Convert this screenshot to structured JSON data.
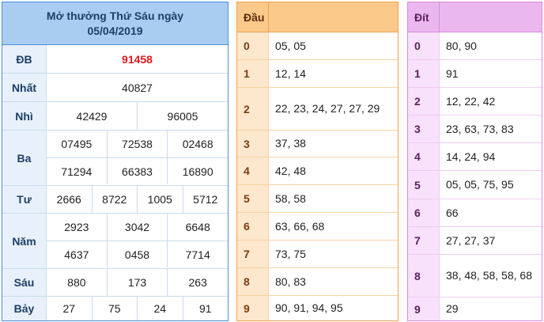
{
  "results": {
    "title_line1": "Mở thưởng Thứ Sáu ngày",
    "title_line2": "05/04/2019",
    "rows": {
      "db": {
        "label": "ĐB",
        "values": [
          "91458"
        ]
      },
      "nhat": {
        "label": "Nhất",
        "values": [
          "40827"
        ]
      },
      "nhi": {
        "label": "Nhì",
        "values": [
          "42429",
          "96005"
        ]
      },
      "ba": {
        "label": "Ba",
        "values": [
          "07495",
          "72538",
          "02468",
          "71294",
          "66383",
          "16890"
        ]
      },
      "tu": {
        "label": "Tư",
        "values": [
          "2666",
          "8722",
          "1005",
          "5712"
        ]
      },
      "nam": {
        "label": "Năm",
        "values": [
          "2923",
          "3042",
          "6648",
          "4637",
          "0458",
          "7714"
        ]
      },
      "sau": {
        "label": "Sáu",
        "values": [
          "880",
          "173",
          "263"
        ]
      },
      "bay": {
        "label": "Bảy",
        "values": [
          "27",
          "75",
          "24",
          "91"
        ]
      }
    }
  },
  "dau": {
    "header": "Đầu",
    "rows": [
      {
        "key": "0",
        "values": "05, 05"
      },
      {
        "key": "1",
        "values": "12, 14"
      },
      {
        "key": "2",
        "values": "22, 23, 24, 27, 27, 29"
      },
      {
        "key": "3",
        "values": "37, 38"
      },
      {
        "key": "4",
        "values": "42, 48"
      },
      {
        "key": "5",
        "values": "58, 58"
      },
      {
        "key": "6",
        "values": "63, 66, 68"
      },
      {
        "key": "7",
        "values": "73, 75"
      },
      {
        "key": "8",
        "values": "80, 83"
      },
      {
        "key": "9",
        "values": "90, 91, 94, 95"
      }
    ]
  },
  "dit": {
    "header": "Đít",
    "rows": [
      {
        "key": "0",
        "values": "80, 90"
      },
      {
        "key": "1",
        "values": "91"
      },
      {
        "key": "2",
        "values": "12, 22, 42"
      },
      {
        "key": "3",
        "values": "23, 63, 73, 83"
      },
      {
        "key": "4",
        "values": "14, 24, 94"
      },
      {
        "key": "5",
        "values": "05, 05, 75, 95"
      },
      {
        "key": "6",
        "values": "66"
      },
      {
        "key": "7",
        "values": "27, 27, 37"
      },
      {
        "key": "8",
        "values": "38, 48, 58, 58, 68"
      },
      {
        "key": "9",
        "values": "29"
      }
    ]
  },
  "colors": {
    "special_prize": "#e0181b",
    "results_border": "#4f8fd6",
    "dau_border": "#f0a450",
    "dit_border": "#d98be0"
  }
}
